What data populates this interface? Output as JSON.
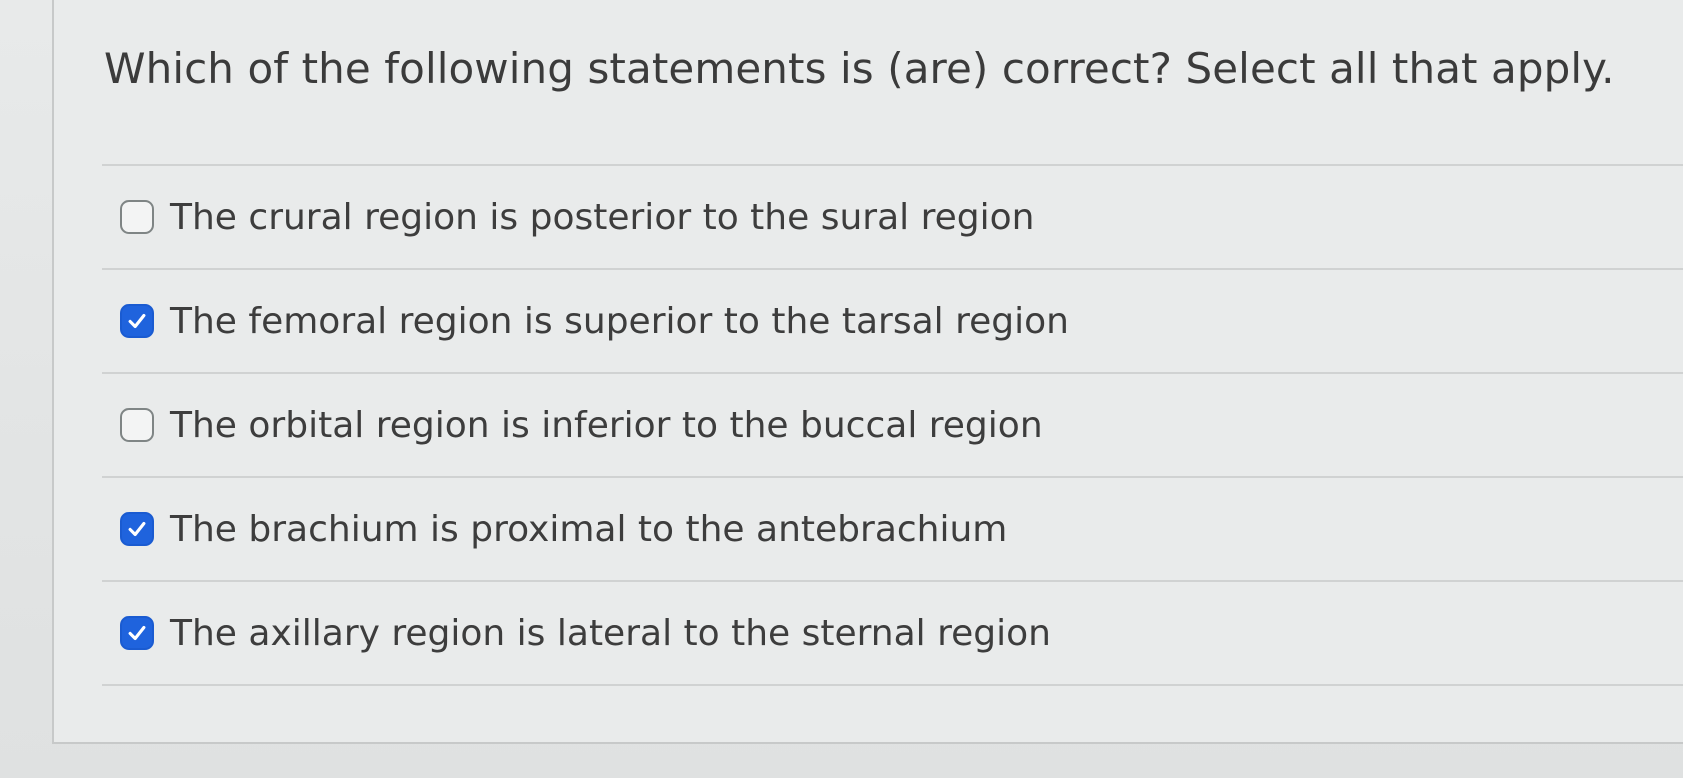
{
  "question": {
    "text": "Which of the following statements is (are) correct? Select all that apply."
  },
  "options": [
    {
      "label": "The crural region is posterior to the sural region",
      "checked": false
    },
    {
      "label": "The femoral region is superior to the tarsal region",
      "checked": true
    },
    {
      "label": "The orbital region is inferior to the buccal region",
      "checked": false
    },
    {
      "label": "The brachium is proximal to the antebrachium",
      "checked": true
    },
    {
      "label": "The axillary region is lateral to the sternal region",
      "checked": true
    }
  ],
  "icons": {
    "checked": "checkmark-icon"
  },
  "colors": {
    "accent": "#1f63dd",
    "text": "#3d3d3d",
    "background": "#e6e8e8"
  }
}
